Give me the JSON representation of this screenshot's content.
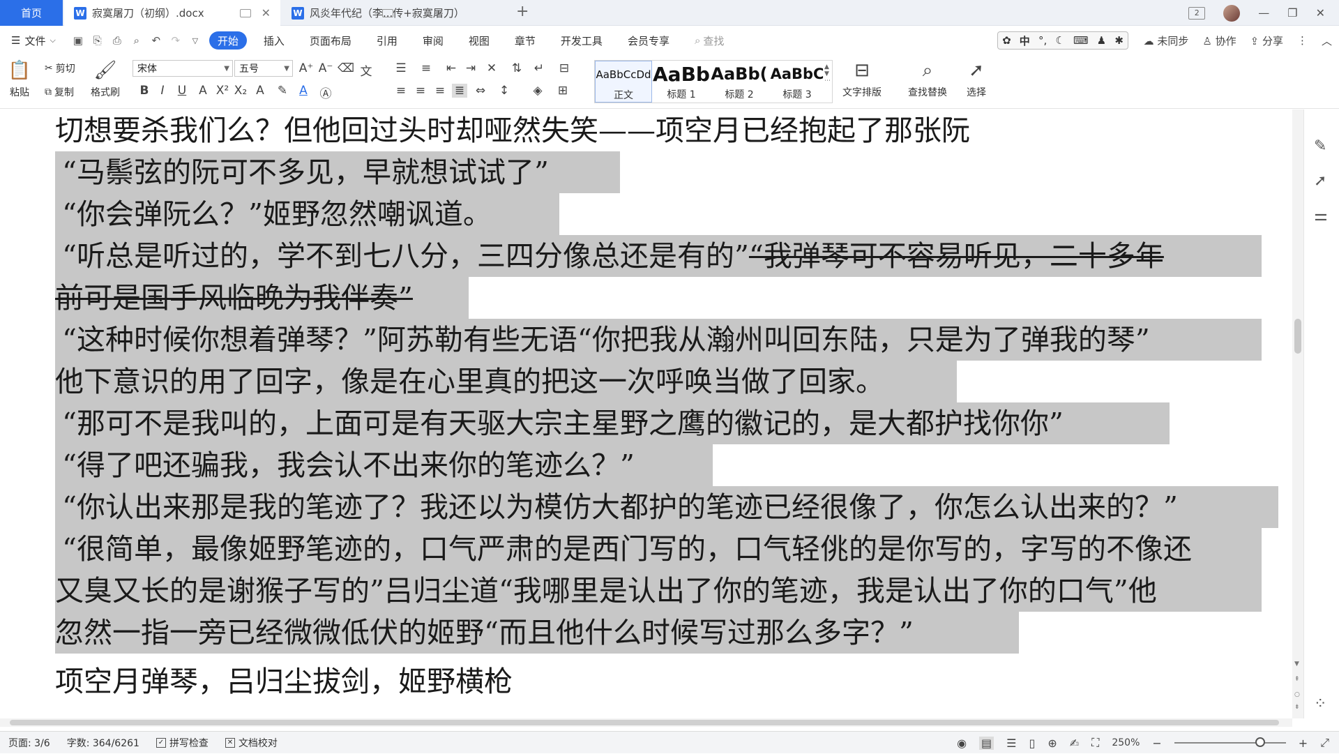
{
  "tabs": {
    "home": "首页",
    "doc1": "寂寞屠刀（初纲）.docx",
    "doc2": "风炎年代纪（李...传+寂寞屠刀）"
  },
  "window": {
    "badge": "2"
  },
  "menu": {
    "file": "文件",
    "items": [
      "开始",
      "插入",
      "页面布局",
      "引用",
      "审阅",
      "视图",
      "章节",
      "开发工具",
      "会员专享"
    ],
    "search": "查找",
    "ime": "中",
    "unsynced": "未同步",
    "collab": "协作",
    "share": "分享"
  },
  "ribbon": {
    "paste": "粘贴",
    "cut": "剪切",
    "copy": "复制",
    "format_painter": "格式刷",
    "font": "宋体",
    "size": "五号",
    "styles": [
      {
        "preview": "AaBbCcDd",
        "label": "正文"
      },
      {
        "preview": "AaBb",
        "label": "标题 1"
      },
      {
        "preview": "AaBb(",
        "label": "标题 2"
      },
      {
        "preview": "AaBbC",
        "label": "标题 3"
      }
    ],
    "text_layout": "文字排版",
    "find_replace": "查找替换",
    "select": "选择"
  },
  "doc_lines": [
    "切想要杀我们么？但他回过头时却哑然失笑——项空月已经抱起了那张阮",
    "“马鬃弦的阮可不多见，早就想试试了”",
    "“你会弹阮么？”姬野忽然嘲讽道。",
    "“听总是听过的，学不到七八分，三四分像总还是有的”",
    "“我弹琴可不容易听见，二十多年",
    "前可是国手风临晚为我伴奏”",
    "“这种时候你想着弹琴？”阿苏勒有些无语“你把我从瀚州叫回东陆，只是为了弹我的琴”",
    "他下意识的用了回字，像是在心里真的把这一次呼唤当做了回家。",
    "“那可不是我叫的，上面可是有天驱大宗主星野之鹰的徽记的，是大都护找你你”",
    "“得了吧还骗我，我会认不出来你的笔迹么？”",
    "“你认出来那是我的笔迹了？我还以为模仿大都护的笔迹已经很像了，你怎么认出来的？”",
    "“很简单，最像姬野笔迹的，口气严肃的是西门写的，口气轻佻的是你写的，字写的不像还",
    "又臭又长的是谢猴子写的”吕归尘道“我哪里是认出了你的笔迹，我是认出了你的口气”他",
    "忽然一指一旁已经微微低伏的姬野“而且他什么时候写过那么多字？”",
    "项空月弹琴，吕归尘拔剑，姬野横枪"
  ],
  "status": {
    "page": "页面: 3/6",
    "words": "字数: 364/6261",
    "spell": "拼写检查",
    "proof": "文档校对",
    "zoom": "250%"
  }
}
